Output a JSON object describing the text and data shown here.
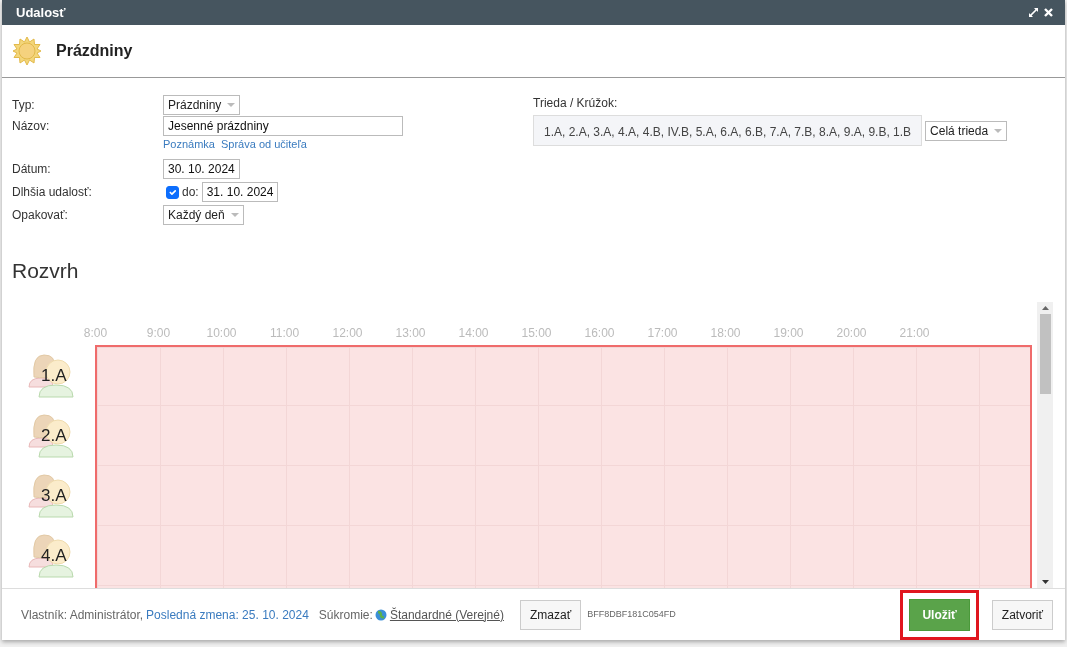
{
  "window": {
    "title": "Udalosť"
  },
  "header": {
    "title": "Prázdniny"
  },
  "form": {
    "type": {
      "label": "Typ:",
      "value": "Prázdniny"
    },
    "name": {
      "label": "Názov:",
      "value": "Jesenné prázdniny",
      "links": [
        "Poznámka",
        "Správa od učiteľa"
      ]
    },
    "date": {
      "label": "Dátum:",
      "value": "30. 10. 2024"
    },
    "longer": {
      "label": "Dlhšia udalosť:",
      "checked": true,
      "to_label": "do:",
      "value": "31. 10. 2024"
    },
    "repeat": {
      "label": "Opakovať:",
      "value": "Každý deň"
    },
    "classes": {
      "label": "Trieda / Krúžok:",
      "value": "1.A, 2.A, 3.A, 4.A, 4.B, IV.B, 5.A, 6.A, 6.B, 7.A, 7.B, 8.A, 9.A, 9.B, 1.B",
      "scope": "Celá trieda"
    }
  },
  "schedule": {
    "title": "Rozvrh",
    "hours": [
      "8:00",
      "9:00",
      "10:00",
      "11:00",
      "12:00",
      "13:00",
      "14:00",
      "15:00",
      "16:00",
      "17:00",
      "18:00",
      "19:00",
      "20:00",
      "21:00"
    ],
    "rows": [
      {
        "label": "1.A"
      },
      {
        "label": "2.A"
      },
      {
        "label": "3.A"
      },
      {
        "label": "4.A"
      }
    ]
  },
  "footer": {
    "owner": "Vlastník: Administrátor,",
    "changed": "Posledná zmena: 25. 10. 2024",
    "privacy_label": "Súkromie:",
    "privacy": "Štandardné (Verejné)",
    "delete_button": "Zmazať",
    "code": "BFF8DBF181C054FD",
    "save_button": {
      "label": "Uložiť",
      "highlighted": true
    },
    "close_button": "Zatvoriť"
  }
}
